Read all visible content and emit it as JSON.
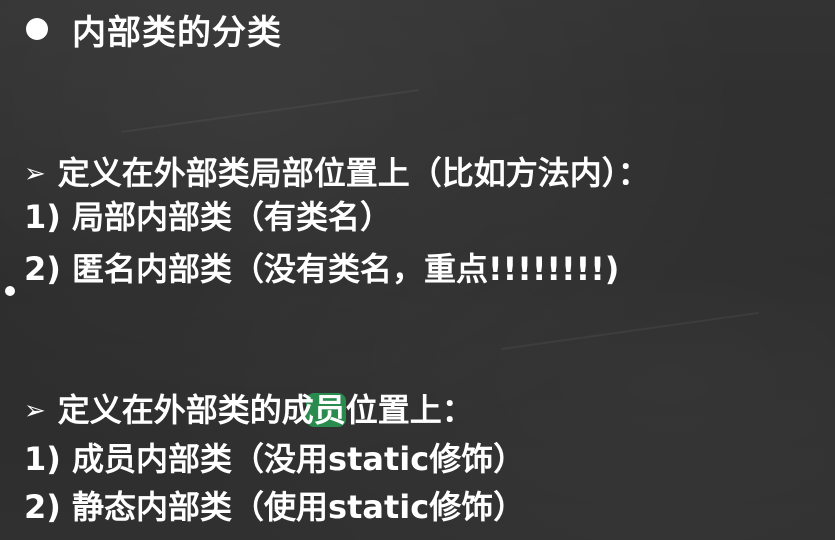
{
  "title": {
    "text": "内部类的分类"
  },
  "sections": [
    {
      "heading": "定义在外部类局部位置上（比如方法内）：",
      "items": [
        "1) 局部内部类（有类名）",
        "2) 匿名内部类（没有类名，重点!!!!!!!!)"
      ]
    },
    {
      "heading": "定义在外部类的成员位置上：",
      "items": [
        "1) 成员内部类（没用static修饰）",
        "2) 静态内部类（使用static修饰）"
      ]
    }
  ],
  "colors": {
    "background": "#2e2e2e",
    "text": "#ffffff",
    "highlight": "#28aa5a"
  },
  "icons": {
    "title_bullet": "filled-circle",
    "section_bullet": "arrowhead-right"
  }
}
